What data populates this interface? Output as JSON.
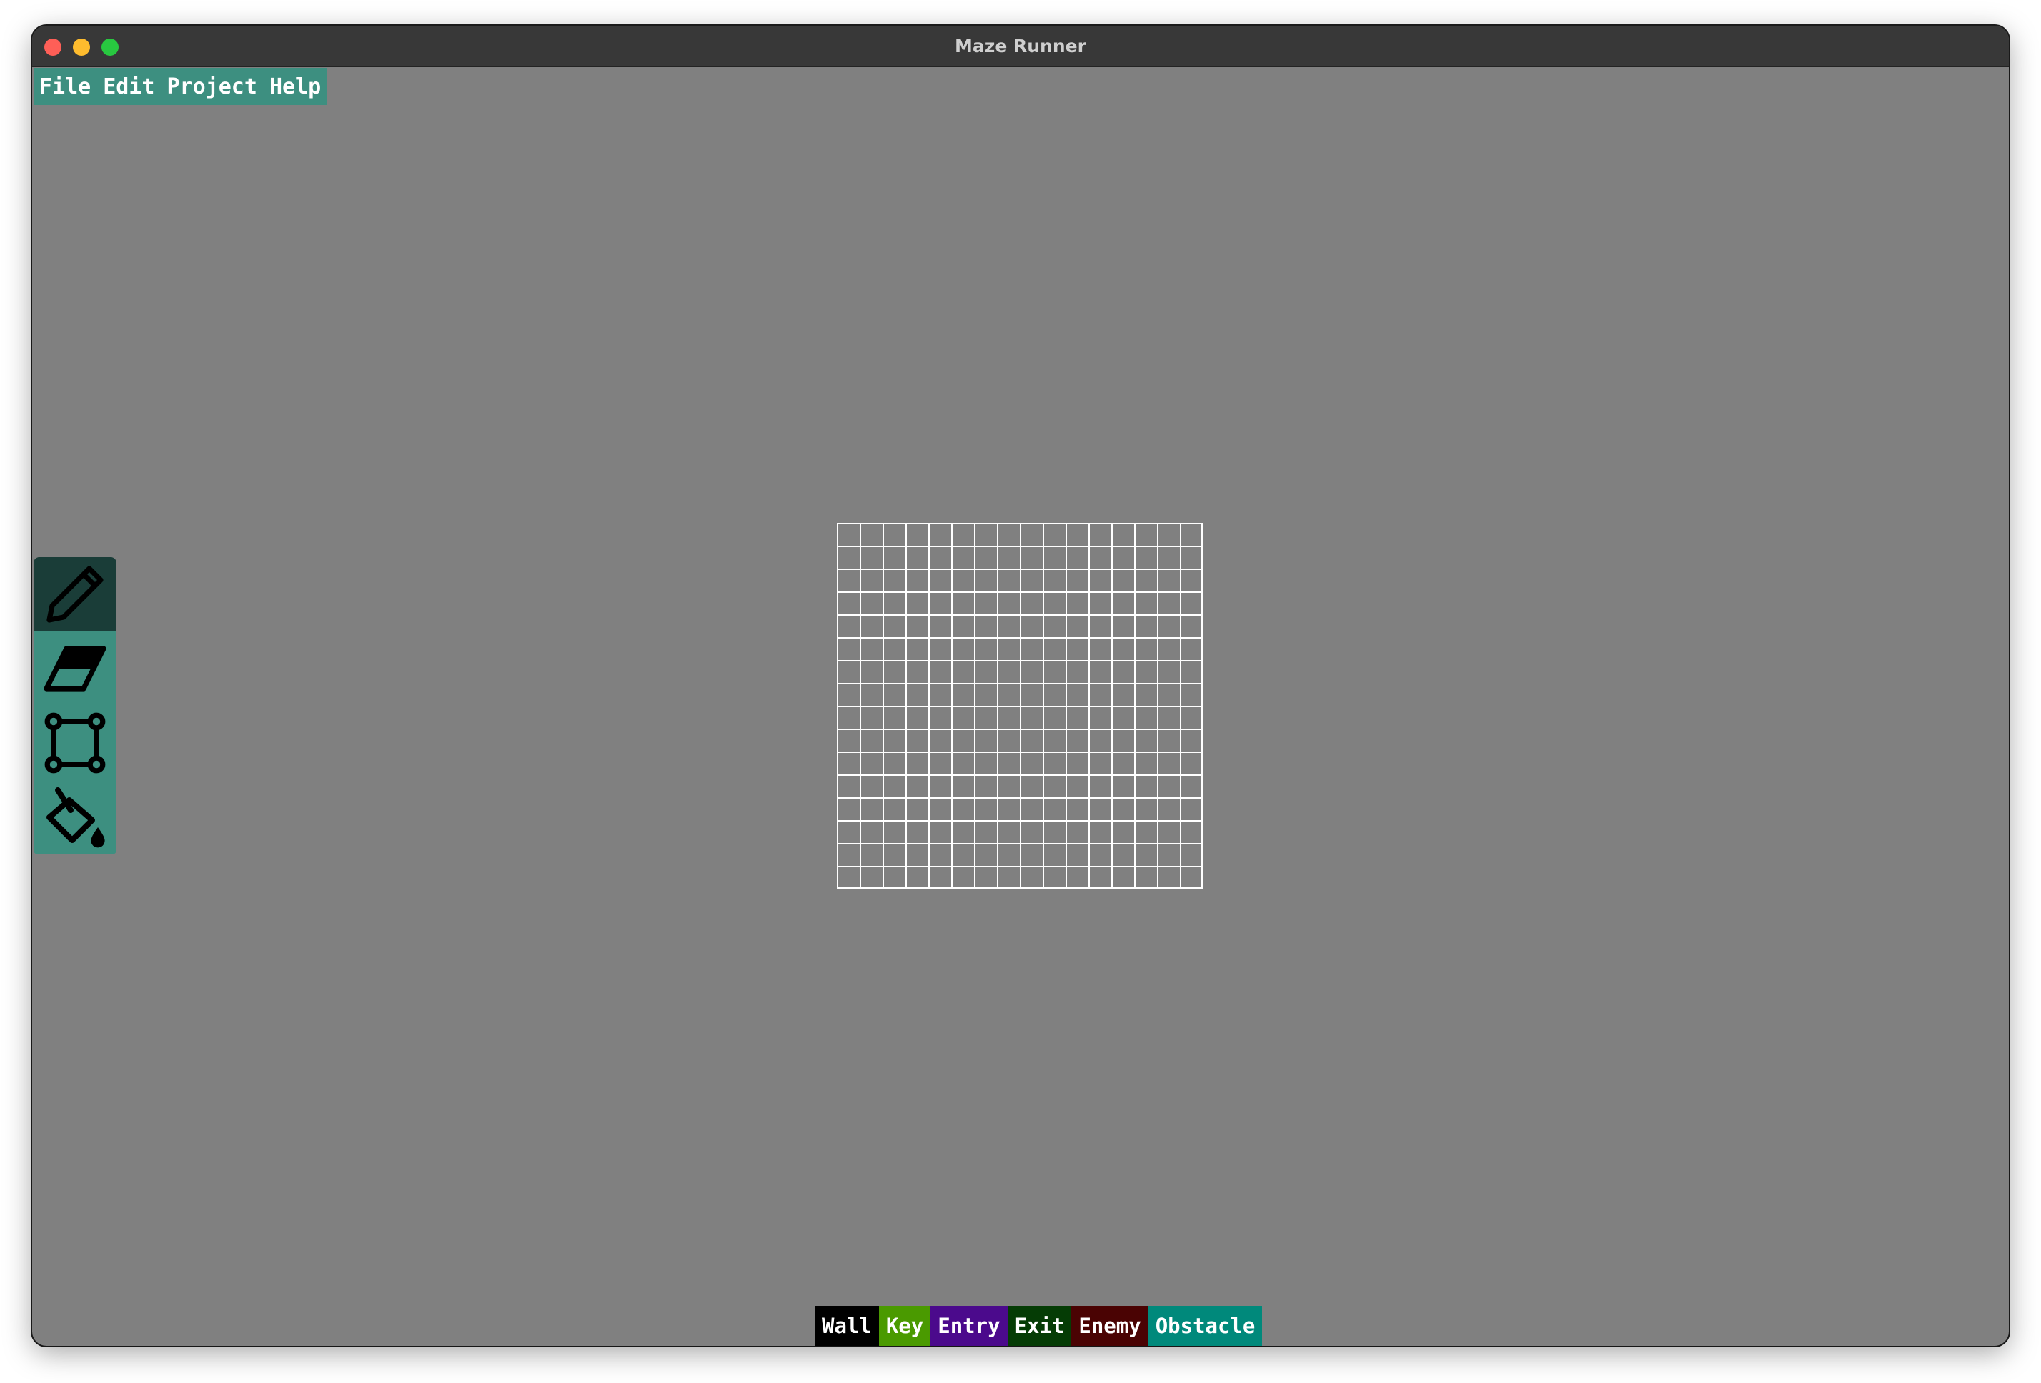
{
  "window": {
    "title": "Maze Runner"
  },
  "menu": {
    "items": [
      {
        "label": "File"
      },
      {
        "label": "Edit"
      },
      {
        "label": "Project"
      },
      {
        "label": "Help"
      }
    ]
  },
  "tools": [
    {
      "name": "pencil-icon",
      "selected": true
    },
    {
      "name": "eraser-icon",
      "selected": false
    },
    {
      "name": "rectangle-select-icon",
      "selected": false
    },
    {
      "name": "paint-bucket-icon",
      "selected": false
    }
  ],
  "grid": {
    "rows": 16,
    "cols": 16
  },
  "palette": [
    {
      "label": "Wall",
      "color": "#000000"
    },
    {
      "label": "Key",
      "color": "#4a9a00"
    },
    {
      "label": "Entry",
      "color": "#4b0a8c"
    },
    {
      "label": "Exit",
      "color": "#053c05"
    },
    {
      "label": "Enemy",
      "color": "#4a0303"
    },
    {
      "label": "Obstacle",
      "color": "#00897b"
    }
  ],
  "colors": {
    "menubar": "#3d8f80",
    "tool_selected": "#1a3d38",
    "canvas_bg": "#808080"
  }
}
